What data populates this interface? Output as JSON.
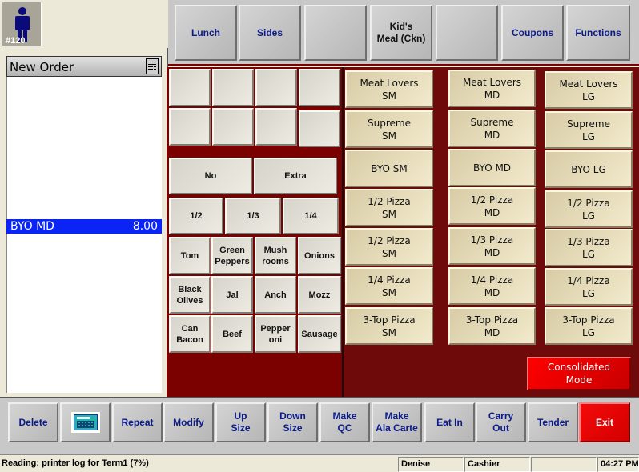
{
  "user_badge": {
    "number": "#120",
    "icon": "person-icon"
  },
  "top_nav": {
    "buttons": [
      {
        "label": "Lunch"
      },
      {
        "label": "Sides"
      },
      {
        "label": ""
      },
      {
        "label": "Kid's\nMeal (Ckn)"
      },
      {
        "label": ""
      },
      {
        "label": "Coupons"
      },
      {
        "label": "Functions"
      }
    ]
  },
  "order": {
    "title": "New Order",
    "header_icon": "document-list-icon",
    "items": [
      {
        "name": "BYO MD",
        "price": "8.00",
        "selected": true
      }
    ]
  },
  "modifiers": {
    "blank_buttons": 8,
    "portion": [
      {
        "label": "No"
      },
      {
        "label": "Extra"
      }
    ],
    "fractions": [
      {
        "label": "1/2"
      },
      {
        "label": "1/3"
      },
      {
        "label": "1/4"
      }
    ],
    "toppings": [
      {
        "label": "Tom"
      },
      {
        "label": "Green\nPeppers"
      },
      {
        "label": "Mush\nrooms"
      },
      {
        "label": "Onions"
      },
      {
        "label": "Black\nOlives"
      },
      {
        "label": "Jal"
      },
      {
        "label": "Anch"
      },
      {
        "label": "Mozz"
      },
      {
        "label": "Can\nBacon"
      },
      {
        "label": "Beef"
      },
      {
        "label": "Pepper\noni"
      },
      {
        "label": "Sausage"
      }
    ]
  },
  "pizzas": {
    "columns": [
      {
        "size": "SM",
        "items": [
          "Meat Lovers\nSM",
          "Supreme\nSM",
          "BYO SM",
          "1/2 Pizza\nSM",
          "1/2 Pizza\nSM",
          "1/4 Pizza\nSM",
          "3-Top Pizza\nSM"
        ]
      },
      {
        "size": "MD",
        "items": [
          "Meat Lovers\nMD",
          "Supreme\nMD",
          "BYO MD",
          "1/2 Pizza\nMD",
          "1/3 Pizza\nMD",
          "1/4 Pizza\nMD",
          "3-Top Pizza\nMD"
        ]
      },
      {
        "size": "LG",
        "items": [
          "Meat Lovers\nLG",
          "Supreme\nLG",
          "BYO LG",
          "1/2 Pizza\nLG",
          "1/3 Pizza\nLG",
          "1/4 Pizza\nLG",
          "3-Top Pizza\nLG"
        ]
      }
    ],
    "mode_button": "Consolidated\nMode"
  },
  "bottom_bar": {
    "buttons": [
      {
        "label": "Delete"
      },
      {
        "label": "",
        "icon": "keyboard-icon"
      },
      {
        "label": "Repeat"
      },
      {
        "label": "Modify"
      },
      {
        "label": "Up\nSize"
      },
      {
        "label": "Down\nSize"
      },
      {
        "label": "Make\nQC"
      },
      {
        "label": "Make\nAla Carte"
      },
      {
        "label": "Eat In"
      },
      {
        "label": "Carry\nOut"
      },
      {
        "label": "Tender"
      },
      {
        "label": "Exit"
      }
    ]
  },
  "status_bar": {
    "message": "Reading: printer log for Term1 (7%)",
    "user": "Denise",
    "role": "Cashier",
    "blank": "",
    "time": "04:27 PM"
  },
  "colors": {
    "selection": "#0A24F5",
    "panel_red": "#7B0000",
    "exit_red": "#F40A0A",
    "nav_text": "#0A1A8A"
  }
}
